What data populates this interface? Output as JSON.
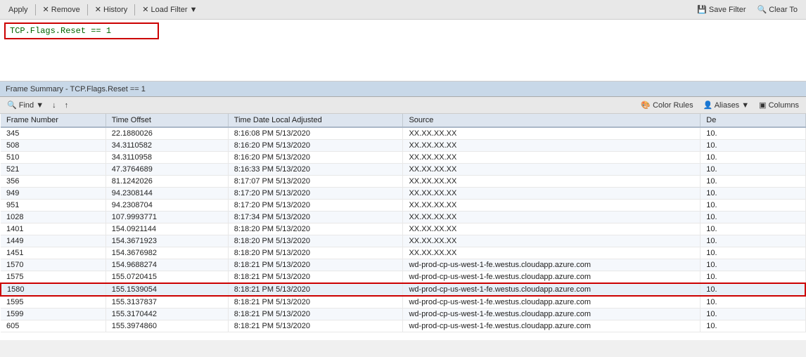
{
  "toolbar": {
    "apply_label": "Apply",
    "remove_label": "✕ Remove",
    "history_label": "✕ History",
    "load_filter_label": "✕ Load Filter ▼",
    "save_filter_label": "💾 Save Filter",
    "clear_label": "🔍 Clear To"
  },
  "filter": {
    "value": "TCP.Flags.Reset == 1"
  },
  "frame_summary": {
    "label": "Frame Summary - TCP.Flags.Reset == 1"
  },
  "find_toolbar": {
    "find_label": "🔍 Find ▼",
    "down_label": "↓",
    "up_label": "↑",
    "color_rules_label": "🎨 Color Rules",
    "aliases_label": "👤 Aliases ▼",
    "columns_label": "▣ Columns"
  },
  "table": {
    "headers": [
      "Frame Number",
      "Time Offset",
      "Time Date Local Adjusted",
      "Source",
      "De"
    ],
    "rows": [
      {
        "frame": "345",
        "offset": "22.1880026",
        "time": "8:16:08 PM 5/13/2020",
        "source": "XX.XX.XX.XX",
        "dest": "10."
      },
      {
        "frame": "508",
        "offset": "34.3110582",
        "time": "8:16:20 PM 5/13/2020",
        "source": "XX.XX.XX.XX",
        "dest": "10."
      },
      {
        "frame": "510",
        "offset": "34.3110958",
        "time": "8:16:20 PM 5/13/2020",
        "source": "XX.XX.XX.XX",
        "dest": "10."
      },
      {
        "frame": "521",
        "offset": "47.3764689",
        "time": "8:16:33 PM 5/13/2020",
        "source": "XX.XX.XX.XX",
        "dest": "10."
      },
      {
        "frame": "356",
        "offset": "81.1242026",
        "time": "8:17:07 PM 5/13/2020",
        "source": "XX.XX.XX.XX",
        "dest": "10."
      },
      {
        "frame": "949",
        "offset": "94.2308144",
        "time": "8:17:20 PM 5/13/2020",
        "source": "XX.XX.XX.XX",
        "dest": "10."
      },
      {
        "frame": "951",
        "offset": "94.2308704",
        "time": "8:17:20 PM 5/13/2020",
        "source": "XX.XX.XX.XX",
        "dest": "10."
      },
      {
        "frame": "1028",
        "offset": "107.9993771",
        "time": "8:17:34 PM 5/13/2020",
        "source": "XX.XX.XX.XX",
        "dest": "10."
      },
      {
        "frame": "1401",
        "offset": "154.0921144",
        "time": "8:18:20 PM 5/13/2020",
        "source": "XX.XX.XX.XX",
        "dest": "10."
      },
      {
        "frame": "1449",
        "offset": "154.3671923",
        "time": "8:18:20 PM 5/13/2020",
        "source": "XX.XX.XX.XX",
        "dest": "10."
      },
      {
        "frame": "1451",
        "offset": "154.3676982",
        "time": "8:18:20 PM 5/13/2020",
        "source": "XX.XX.XX.XX",
        "dest": "10."
      },
      {
        "frame": "1570",
        "offset": "154.9688274",
        "time": "8:18:21 PM 5/13/2020",
        "source": "wd-prod-cp-us-west-1-fe.westus.cloudapp.azure.com",
        "dest": "10."
      },
      {
        "frame": "1575",
        "offset": "155.0720415",
        "time": "8:18:21 PM 5/13/2020",
        "source": "wd-prod-cp-us-west-1-fe.westus.cloudapp.azure.com",
        "dest": "10."
      },
      {
        "frame": "1580",
        "offset": "155.1539054",
        "time": "8:18:21 PM 5/13/2020",
        "source": "wd-prod-cp-us-west-1-fe.westus.cloudapp.azure.com",
        "dest": "10.",
        "highlight": true
      },
      {
        "frame": "1595",
        "offset": "155.3137837",
        "time": "8:18:21 PM 5/13/2020",
        "source": "wd-prod-cp-us-west-1-fe.westus.cloudapp.azure.com",
        "dest": "10."
      },
      {
        "frame": "1599",
        "offset": "155.3170442",
        "time": "8:18:21 PM 5/13/2020",
        "source": "wd-prod-cp-us-west-1-fe.westus.cloudapp.azure.com",
        "dest": "10."
      },
      {
        "frame": "605",
        "offset": "155.3974860",
        "time": "8:18:21 PM 5/13/2020",
        "source": "wd-prod-cp-us-west-1-fe.westus.cloudapp.azure.com",
        "dest": "10."
      }
    ]
  }
}
